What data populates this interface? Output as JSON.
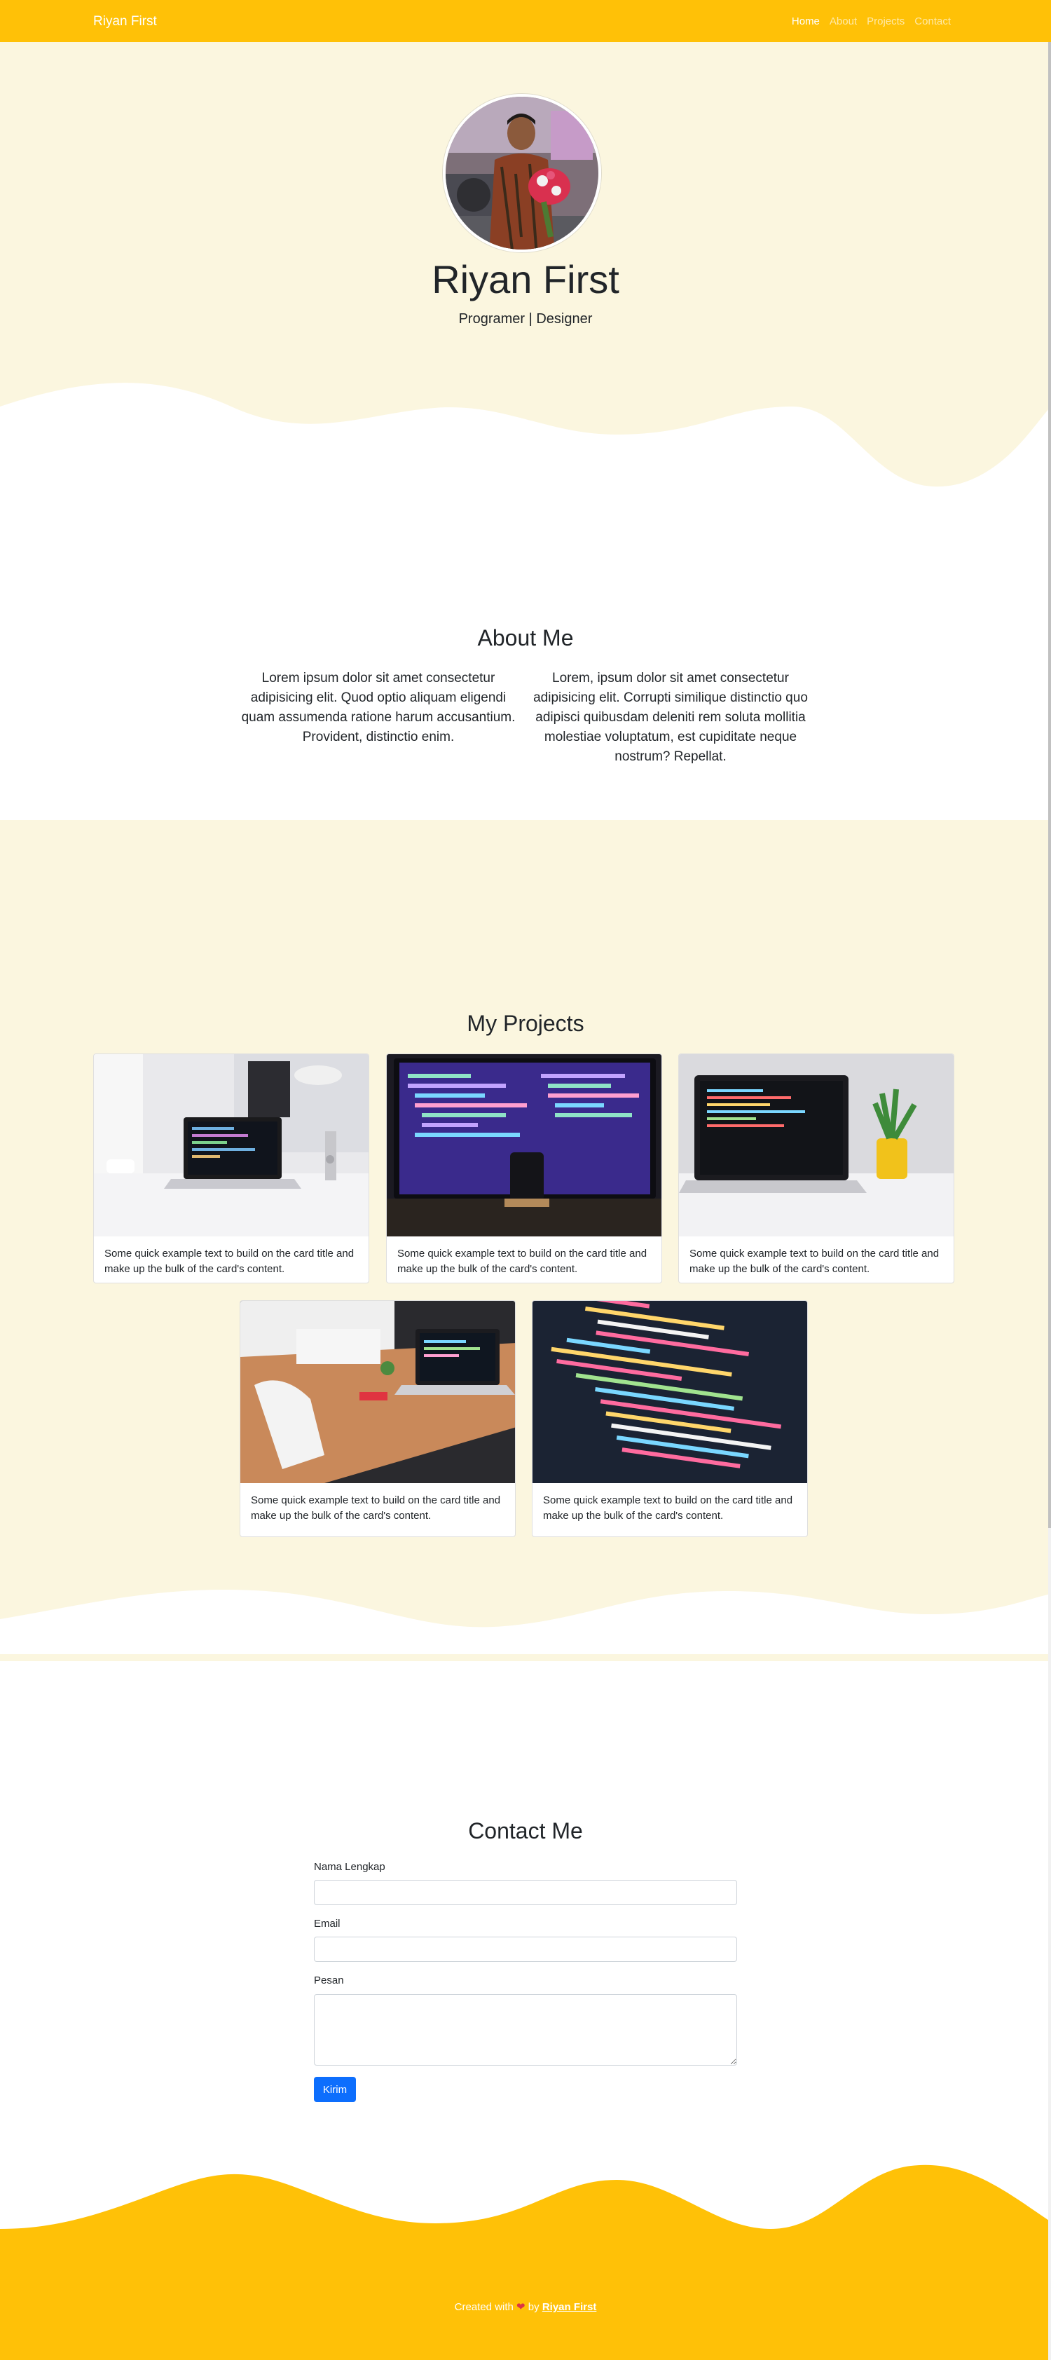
{
  "navbar": {
    "brand": "Riyan First",
    "links": [
      "Home",
      "About",
      "Projects",
      "Contact"
    ],
    "color": "#ffc107"
  },
  "hero": {
    "name": "Riyan First",
    "subtitle": "Programer | Designer",
    "background": "#fbf6df"
  },
  "about": {
    "title": "About Me",
    "col1": "Lorem ipsum dolor sit amet consectetur adipisicing elit. Quod optio aliquam eligendi quam assumenda ratione harum accusantium. Provident, distinctio enim.",
    "col2": "Lorem, ipsum dolor sit amet consectetur adipisicing elit. Corrupti similique distinctio quo adipisci quibusdam deleniti rem soluta mollitia molestiae voluptatum, est cupiditate neque nostrum? Repellat."
  },
  "projects": {
    "title": "My Projects",
    "cards": [
      {
        "text": "Some quick example text to build on the card title and make up the bulk of the card's content."
      },
      {
        "text": "Some quick example text to build on the card title and make up the bulk of the card's content."
      },
      {
        "text": "Some quick example text to build on the card title and make up the bulk of the card's content."
      },
      {
        "text": "Some quick example text to build on the card title and make up the bulk of the card's content."
      },
      {
        "text": "Some quick example text to build on the card title and make up the bulk of the card's content."
      }
    ]
  },
  "contact": {
    "title": "Contact Me",
    "name_label": "Nama Lengkap",
    "email_label": "Email",
    "message_label": "Pesan",
    "submit_label": "Kirim"
  },
  "footer": {
    "prefix": "Created with",
    "middle": "by",
    "author": "Riyan First",
    "color": "#ffc107"
  }
}
